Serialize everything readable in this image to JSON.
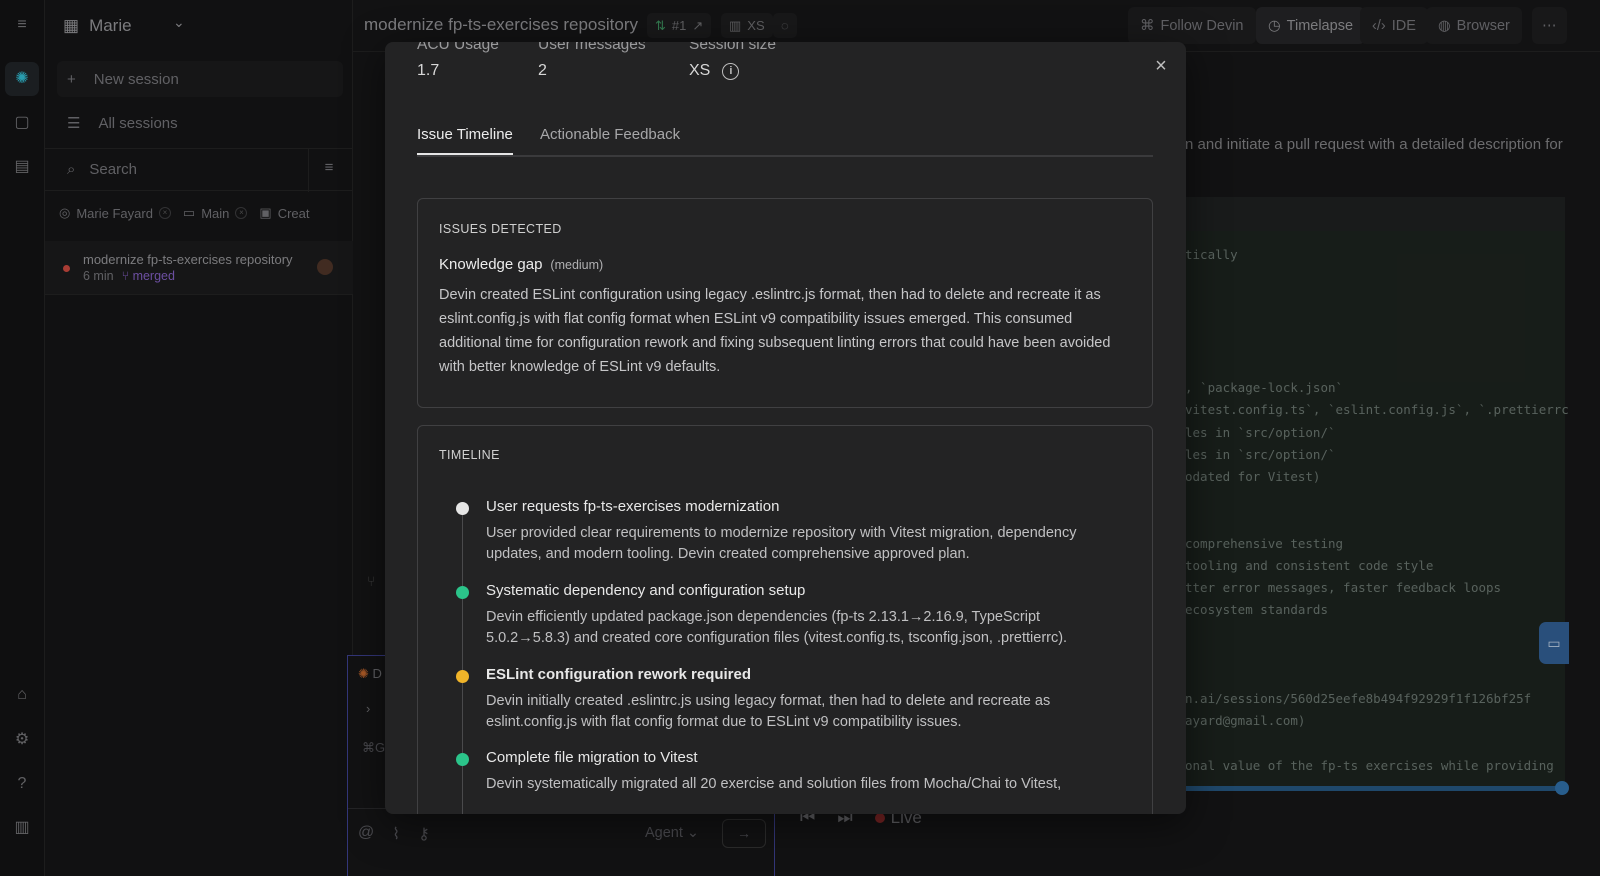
{
  "sidebar": {
    "workspace_name": "Marie",
    "new_session": "New session",
    "all_sessions": "All sessions",
    "search_placeholder": "Search",
    "chips": [
      "Marie Fayard",
      "Main",
      "Creat"
    ],
    "session": {
      "title": "modernize fp-ts-exercises repository",
      "age": "6 min",
      "status": "merged"
    }
  },
  "topbar": {
    "title": "modernize fp-ts-exercises repository",
    "pr": "#1",
    "size": "XS",
    "follow": "Follow Devin",
    "timelapse": "Timelapse",
    "ide": "IDE",
    "browser": "Browser"
  },
  "background": {
    "content_line": "n and initiate a pull request with a detailed description for",
    "code_lines": [
      "tically",
      ", `package-lock.json`",
      "vitest.config.ts`, `eslint.config.js`, `.prettierrc",
      "les in `src/option/`",
      "les in `src/option/`",
      "odated for Vitest)",
      " comprehensive testing",
      "tooling and consistent code style",
      "tter error messages, faster feedback loops",
      "ecosystem standards",
      "n.ai/sessions/560d25eefe8b494f92929f1f126bf25f",
      "ayard@gmail.com)",
      "onal value of the fp-ts exercises while providing"
    ],
    "live": "Live",
    "agent": "Agent",
    "chat_partial_1": "D",
    "chat_partial_2": "⌘G"
  },
  "modal": {
    "stats": [
      {
        "label": "ACU Usage",
        "value": "1.7"
      },
      {
        "label": "User messages",
        "value": "2"
      },
      {
        "label": "Session size",
        "value": "XS"
      }
    ],
    "tabs": [
      "Issue Timeline",
      "Actionable Feedback"
    ],
    "issues": {
      "heading": "ISSUES DETECTED",
      "title": "Knowledge gap",
      "severity": "(medium)",
      "description": "Devin created ESLint configuration using legacy .eslintrc.js format, then had to delete and recreate it as eslint.config.js with flat config format when ESLint v9 compatibility issues emerged. This consumed additional time for configuration rework and fixing subsequent linting errors that could have been avoided with better knowledge of ESLint v9 defaults."
    },
    "timeline": {
      "heading": "TIMELINE",
      "items": [
        {
          "title": "User requests fp-ts-exercises modernization",
          "desc": "User provided clear requirements to modernize repository with Vitest migration, dependency updates, and modern tooling. Devin created comprehensive approved plan.",
          "color": "#e6e6e6"
        },
        {
          "title": "Systematic dependency and configuration setup",
          "desc": "Devin efficiently updated package.json dependencies (fp-ts 2.13.1→2.16.9, TypeScript 5.0.2→5.8.3) and created core configuration files (vitest.config.ts, tsconfig.json, .prettierrc).",
          "color": "#2bc48a"
        },
        {
          "title": "ESLint configuration rework required",
          "desc": "Devin initially created .eslintrc.js using legacy format, then had to delete and recreate as eslint.config.js with flat config format due to ESLint v9 compatibility issues.",
          "color": "#f0b429"
        },
        {
          "title": "Complete file migration to Vitest",
          "desc": "Devin systematically migrated all 20 exercise and solution files from Mocha/Chai to Vitest,",
          "color": "#2bc48a"
        }
      ]
    }
  }
}
